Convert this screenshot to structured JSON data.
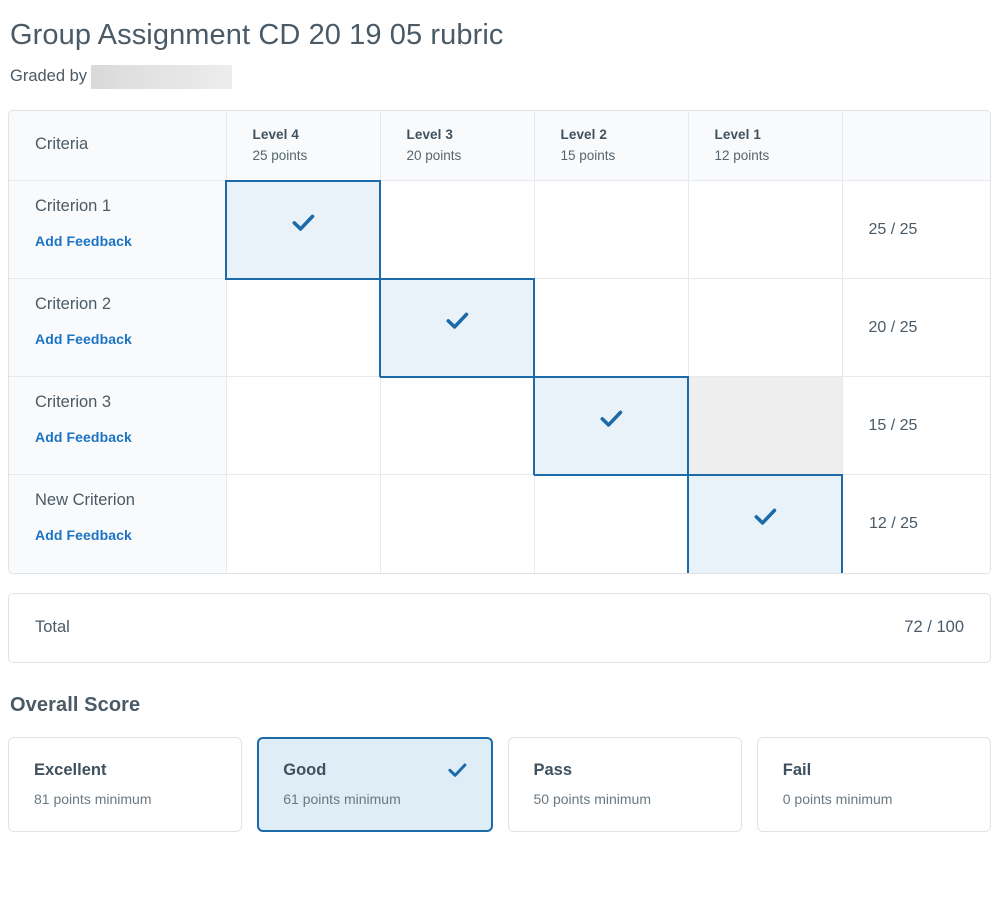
{
  "header": {
    "title": "Group Assignment CD 20 19 05 rubric",
    "graded_by_label": "Graded by",
    "graded_by_value": "",
    "graded_by_redacted": true
  },
  "colors": {
    "accent_blue": "#1c6aa8",
    "link_blue": "#1b73c4",
    "selected_fill": "#e9f2f9",
    "hover_gray": "#eeeeef",
    "text": "#4a5a66",
    "border": "#dfe3e8"
  },
  "rubric": {
    "criteria_header": "Criteria",
    "levels": [
      {
        "name": "Level 4",
        "points": "25 points"
      },
      {
        "name": "Level 3",
        "points": "20 points"
      },
      {
        "name": "Level 2",
        "points": "15 points"
      },
      {
        "name": "Level 1",
        "points": "12 points"
      }
    ],
    "score_header": "",
    "add_feedback_label": "Add Feedback",
    "rows": [
      {
        "criterion": "Criterion 1",
        "selected_level": 0,
        "hovered_level": -1,
        "score": "25 / 25"
      },
      {
        "criterion": "Criterion 2",
        "selected_level": 1,
        "hovered_level": -1,
        "score": "20 / 25"
      },
      {
        "criterion": "Criterion 3",
        "selected_level": 2,
        "hovered_level": 3,
        "score": "15 / 25"
      },
      {
        "criterion": "New Criterion",
        "selected_level": 3,
        "hovered_level": -1,
        "score": "12 / 25"
      }
    ],
    "total_label": "Total",
    "total_value": "72 / 100"
  },
  "overall_score": {
    "heading": "Overall Score",
    "options": [
      {
        "name": "Excellent",
        "minimum": "81 points minimum",
        "selected": false
      },
      {
        "name": "Good",
        "minimum": "61 points minimum",
        "selected": true
      },
      {
        "name": "Pass",
        "minimum": "50 points minimum",
        "selected": false
      },
      {
        "name": "Fail",
        "minimum": "0 points minimum",
        "selected": false
      }
    ]
  },
  "icons": {
    "check": "check-icon"
  }
}
